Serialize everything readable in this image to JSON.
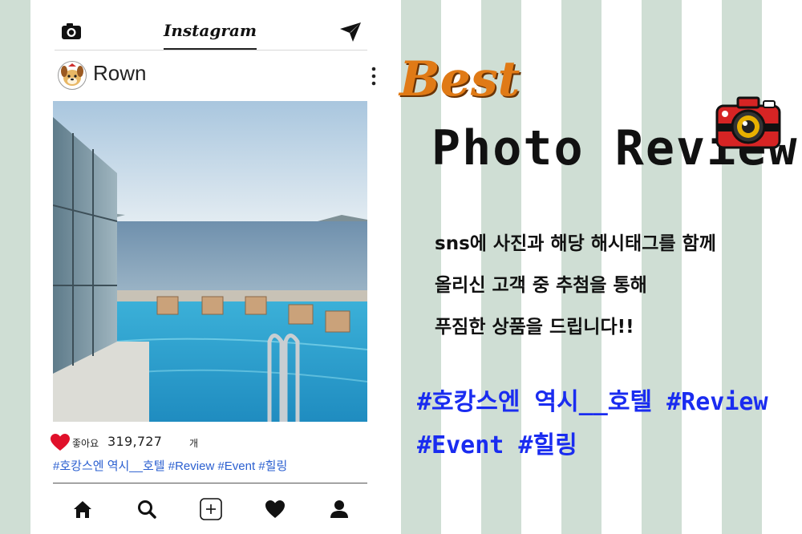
{
  "topbar": {
    "app_title": "Instagram",
    "camera_icon": "camera-icon",
    "send_icon": "send-icon"
  },
  "post": {
    "username": "Rown",
    "avatar_icon": "dog-avatar-icon",
    "more_icon": "more-vertical-icon",
    "likes_label": "좋아요",
    "likes_count": "319,727",
    "likes_unit": "개",
    "hashtags": "#호캉스엔 역시__호텔 #Review #Event #힐링"
  },
  "nav": {
    "items": [
      "home-icon",
      "search-icon",
      "add-post-icon",
      "heart-icon",
      "profile-icon"
    ]
  },
  "promo": {
    "best": "Best",
    "headline": "Photo Review",
    "desc": [
      "sns에 사진과 해당 해시태그를 함께",
      "올리신 고객 중 추첨을 통해",
      "푸짐한 상품을 드립니다!!"
    ],
    "tags": [
      "#호캉스엔 역시__호텔 #Review",
      "#Event #힐링"
    ]
  },
  "colors": {
    "stripe": "#cfded4",
    "best_orange": "#e07a16",
    "tag_blue": "#1a2cf0",
    "hashtag_blue": "#2a5fd0",
    "heart_red": "#e0102a"
  }
}
